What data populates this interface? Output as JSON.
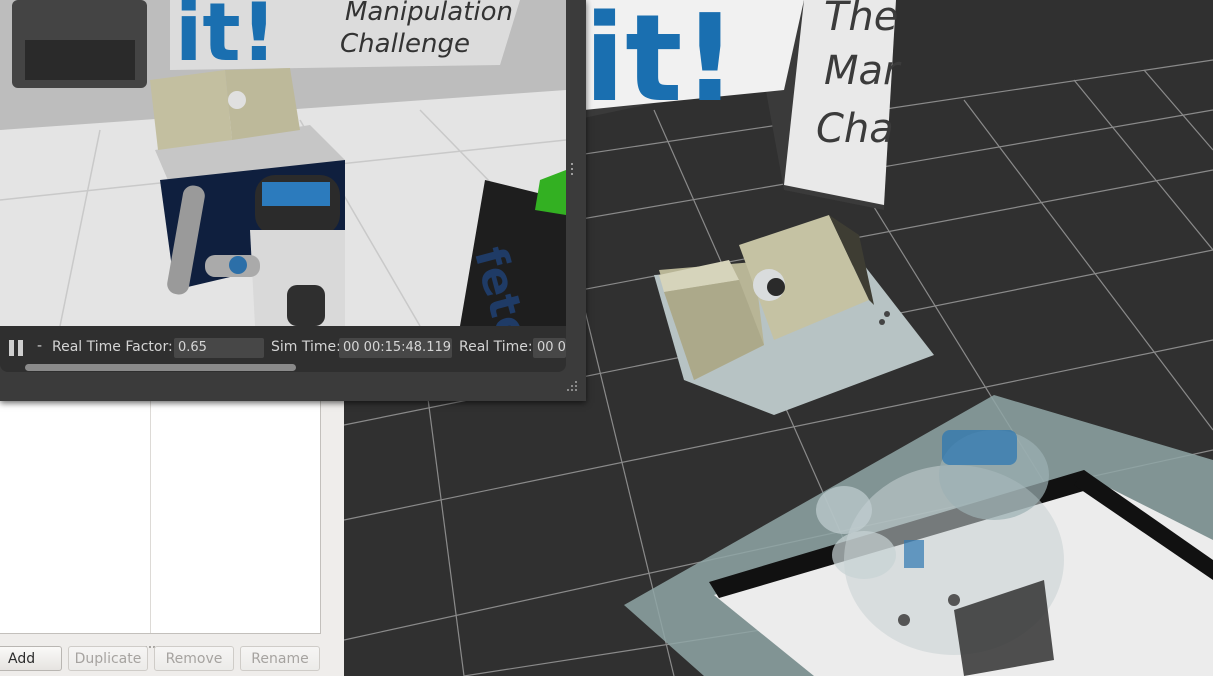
{
  "panel": {
    "buttons": {
      "add": "Add",
      "duplicate": "Duplicate",
      "remove": "Remove",
      "rename": "Rename"
    }
  },
  "gazebo": {
    "real_time_factor_label": "Real Time Factor:",
    "real_time_factor_value": "0.65",
    "sim_time_label": "Sim Time:",
    "sim_time_value": "00 00:15:48.119",
    "real_time_label": "Real Time:",
    "real_time_value": "00 0",
    "step_marker": "-",
    "scene_text": {
      "banner_line1": "Manipulation",
      "banner_line2": "Challenge",
      "banner_logo": "it!",
      "table_logo": "fetc"
    }
  },
  "viewport": {
    "banner_text": [
      "The",
      "Mar",
      "Cha"
    ],
    "logo_text": "it!"
  },
  "colors": {
    "viewport_bg": "#303030",
    "grid_line": "#8a8a8a",
    "panel_bg": "#efedeb",
    "brand_blue": "#1a6fb0"
  }
}
